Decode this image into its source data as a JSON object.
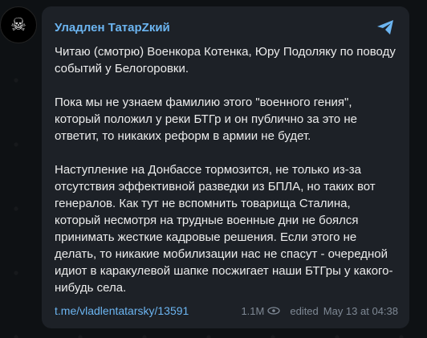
{
  "post": {
    "sender": "Уладлен ТатарZкий",
    "paragraphs": [
      "Читаю (смотрю) Военкора Котенка, Юру Подоляку по поводу событий у Белогоровки.",
      "Пока мы не узнаем фамилию этого \"военного гения\", который положил у реки БТГр и он публично за это не ответит, то никаких реформ в армии не будет.",
      "Наступление на Донбассе тормозится, не только из-за отсутствия эффективной разведки из БПЛА, но таких вот генералов. Как тут не вспомнить товарища Сталина, который несмотря на трудные военные дни не боялся принимать жесткие кадровые решения. Если этого не делать, то никакие мобилизации нас не спасут - очередной идиот в каракулевой шапке посжигает наши БТГры у какого-нибудь села."
    ],
    "link": "t.me/vladlentatarsky/13591",
    "views": "1.1M",
    "edited_label": "edited",
    "date": "May 13 at 04:38"
  },
  "icons": {
    "avatar": "skull-crossbones-icon",
    "share": "share-arrow-icon",
    "views": "eye-icon"
  },
  "colors": {
    "bubble": "#1d2127",
    "accent": "#6cb5f1",
    "text": "#ececec",
    "meta": "#7e8894",
    "background": "#0e1114"
  }
}
